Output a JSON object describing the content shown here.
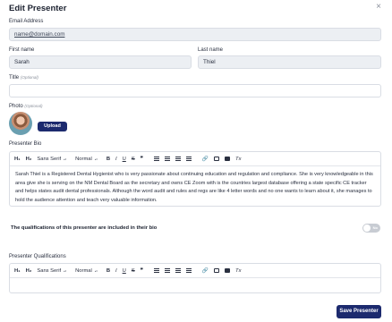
{
  "dialog": {
    "title": "Edit Presenter",
    "close_glyph": "×"
  },
  "email": {
    "label": "Email Address",
    "value": "name@domain.com"
  },
  "first_name": {
    "label": "First name",
    "value": "Sarah"
  },
  "last_name": {
    "label": "Last name",
    "value": "Thiel"
  },
  "title_field": {
    "label": "Title",
    "optional": "(Optional)",
    "value": ""
  },
  "photo": {
    "label": "Photo",
    "optional": "(Optional)",
    "upload_label": "Upload"
  },
  "bio": {
    "label": "Presenter Bio",
    "text": "Sarah Thiel is a Registered Dental Hygienist who is very passionate about continuing education and regulation and compliance. She is very knowledgeable in this area give she is serving on the NM Dental Board as the secretary and owns CE Zoom with is the countries largest database offering a state specific CE tracker and helps states audit dental professionals. Although the word audit and rules and regs are like 4 letter words and no one wants to learn about it, she manages to hold the audience attention and teach very valuable information."
  },
  "toolbar": {
    "h1": "H₁",
    "h2": "H₂",
    "font": "Sans Serif",
    "size": "Normal",
    "bold": "B",
    "italic": "I",
    "underline": "U",
    "strike": "S",
    "quote": "❞",
    "clear": "Tx"
  },
  "qualifications_toggle": {
    "label": "The qualifications of this presenter are included in their bio",
    "state": "No"
  },
  "qualifications": {
    "label": "Presenter Qualifications",
    "text": ""
  },
  "save_label": "Save Presenter"
}
